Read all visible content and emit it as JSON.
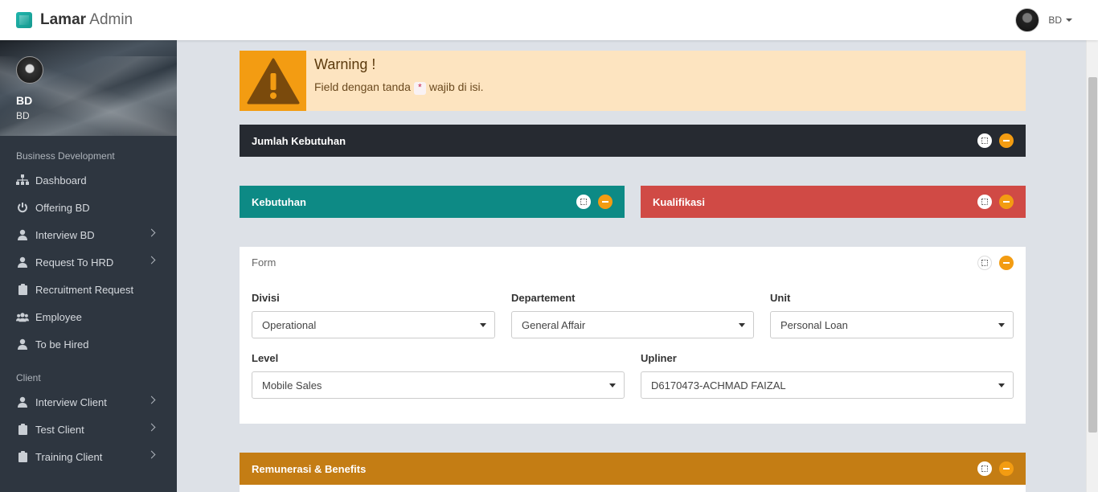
{
  "topbar": {
    "brand_bold": "Lamar",
    "brand_light": "Admin",
    "username": "BD"
  },
  "sidebar": {
    "profile_name": "BD",
    "profile_role": "BD",
    "sections": [
      {
        "header": "Business Development"
      },
      {
        "header": "Client"
      }
    ],
    "items": [
      {
        "label": "Dashboard",
        "icon": "sitemap-icon",
        "has_children": false
      },
      {
        "label": "Offering BD",
        "icon": "power-icon",
        "has_children": false
      },
      {
        "label": "Interview BD",
        "icon": "user-icon",
        "has_children": true
      },
      {
        "label": "Request To HRD",
        "icon": "user-icon",
        "has_children": true
      },
      {
        "label": "Recruitment Request",
        "icon": "clipboard-icon",
        "has_children": false
      },
      {
        "label": "Employee",
        "icon": "users-icon",
        "has_children": false
      },
      {
        "label": "To be Hired",
        "icon": "user-icon",
        "has_children": false
      },
      {
        "label": "Interview Client",
        "icon": "user-icon",
        "has_children": true
      },
      {
        "label": "Test Client",
        "icon": "clipboard-icon",
        "has_children": true
      },
      {
        "label": "Training Client",
        "icon": "clipboard-icon",
        "has_children": true
      }
    ]
  },
  "alert": {
    "title": "Warning !",
    "text_before": "Field dengan tanda",
    "marker": "*",
    "text_after": "wajib di isi."
  },
  "panels": {
    "jumlah": "Jumlah Kebutuhan",
    "kebutuhan": "Kebutuhan",
    "kualifikasi": "Kualifikasi",
    "form": "Form",
    "remunerasi": "Remunerasi & Benefits"
  },
  "colors": {
    "jumlah": "#262a31",
    "kebutuhan": "#0d8a85",
    "kualifikasi": "#d04a45",
    "remunerasi": "#c47d14",
    "warning_accent": "#f39c12"
  },
  "form": {
    "divisi": {
      "label": "Divisi",
      "value": "Operational"
    },
    "departement": {
      "label": "Departement",
      "value": "General Affair"
    },
    "unit": {
      "label": "Unit",
      "value": "Personal Loan"
    },
    "level": {
      "label": "Level",
      "value": "Mobile Sales"
    },
    "upliner": {
      "label": "Upliner",
      "value": "D6170473-ACHMAD FAIZAL"
    }
  }
}
